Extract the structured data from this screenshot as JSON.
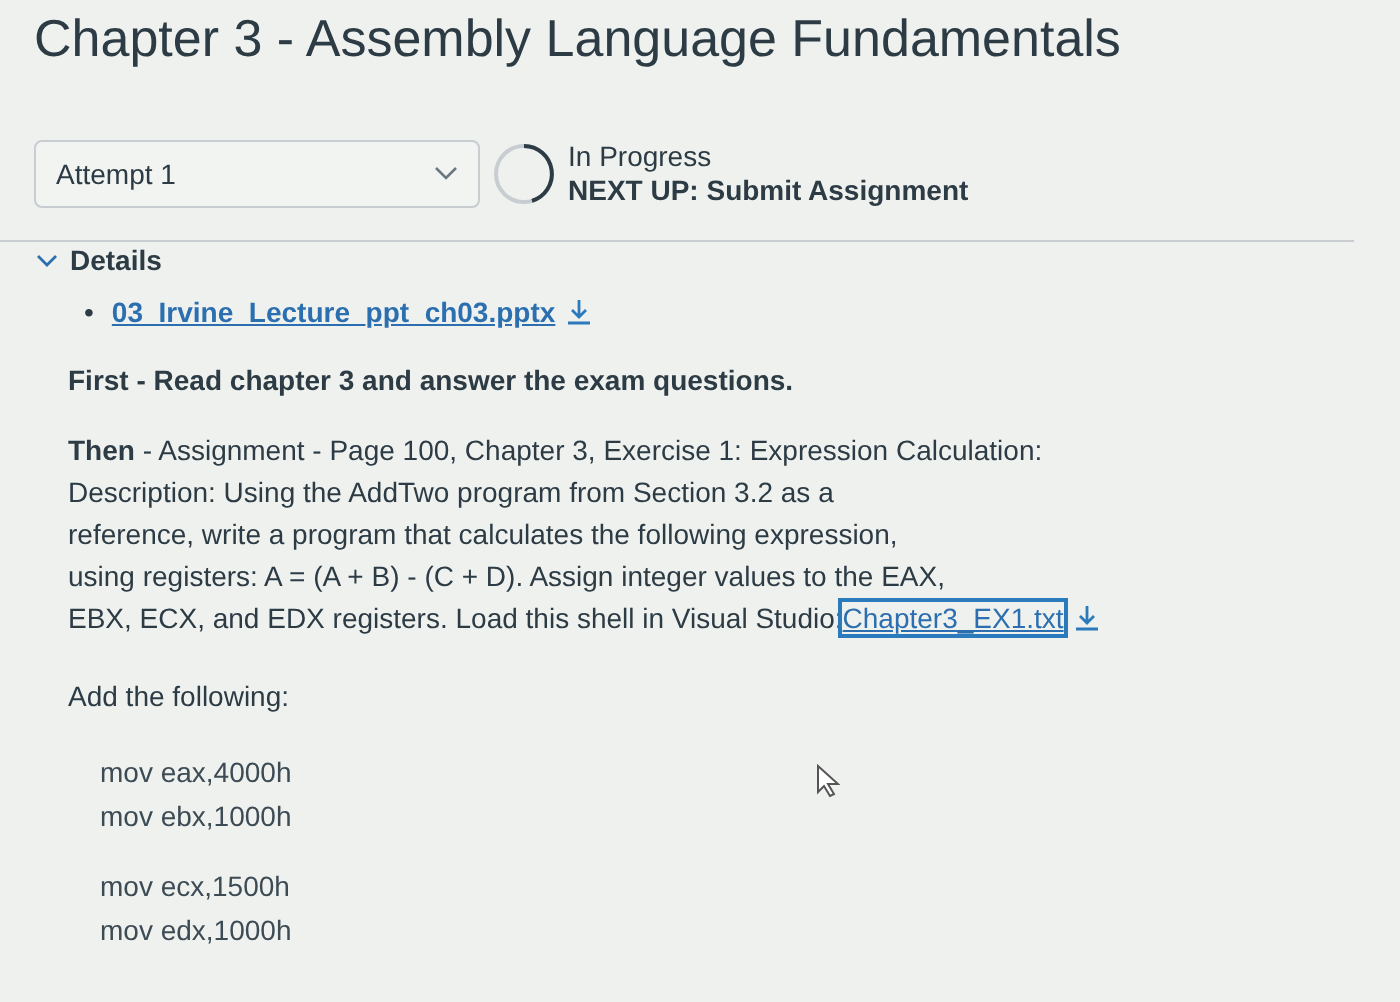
{
  "page_title": "Chapter 3 - Assembly Language Fundamentals",
  "attempt_select": {
    "value": "Attempt 1"
  },
  "progress": {
    "status": "In Progress",
    "next_up": "NEXT UP: Submit Assignment"
  },
  "details": {
    "label": "Details",
    "expanded": true,
    "attachments": [
      {
        "bullet": "•",
        "name": "03_Irvine_Lecture_ppt_ch03.pptx"
      }
    ],
    "intro": "First - Read chapter 3 and answer the exam questions.",
    "description_lines": [
      "**Then** - Assignment - Page 100, Chapter 3, Exercise 1: Expression Calculation:",
      "Description: Using the AddTwo program from Section 3.2 as a",
      "reference, write a program that calculates the following expression,",
      "using registers: A = (A + B) - (C + D). Assign integer values to the EAX,",
      "EBX, ECX, and EDX registers. Load this shell in Visual Studio:"
    ],
    "shell_link": "Chapter3_EX1.txt",
    "add_heading": "Add the following:",
    "code_groups": [
      [
        "mov eax,4000h",
        "mov ebx,1000h"
      ],
      [
        "mov ecx,1500h",
        "mov edx,1000h"
      ]
    ]
  }
}
